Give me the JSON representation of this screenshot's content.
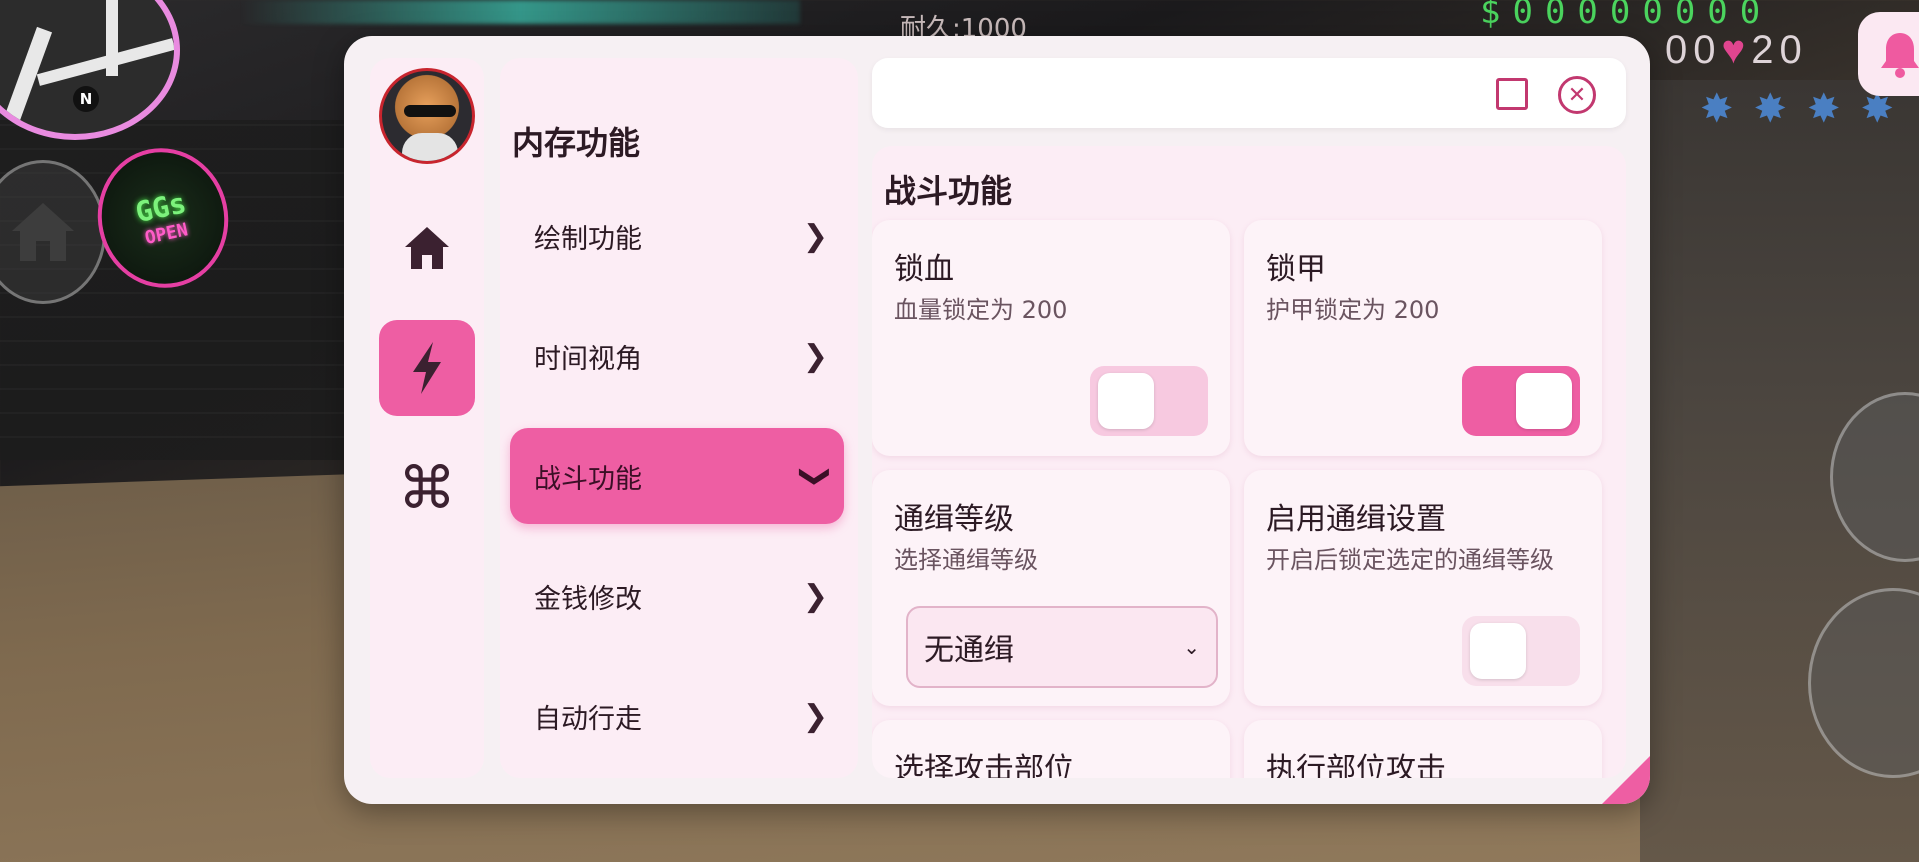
{
  "hud": {
    "durability": "耐久:1000",
    "money": "$00000000",
    "stats": "00",
    "heart": "♥",
    "lives": "20",
    "wanted_stars": "✸✸✸✸"
  },
  "minimap": {
    "north": "N"
  },
  "badge": {
    "main": "GGs",
    "sub": "OPEN"
  },
  "menu": {
    "title": "内存功能",
    "categories": [
      {
        "label": "绘制功能"
      },
      {
        "label": "时间视角"
      },
      {
        "label": "战斗功能"
      },
      {
        "label": "金钱修改"
      },
      {
        "label": "自动行走"
      }
    ],
    "active_category": "战斗功能",
    "section_title": "战斗功能",
    "cards": {
      "lock_health": {
        "title": "锁血",
        "desc": "血量锁定为 200",
        "enabled": false
      },
      "lock_armor": {
        "title": "锁甲",
        "desc": "护甲锁定为 200",
        "enabled": true
      },
      "wanted_level": {
        "title": "通缉等级",
        "desc": "选择通缉等级",
        "value": "无通缉"
      },
      "wanted_enable": {
        "title": "启用通缉设置",
        "desc": "开启后锁定选定的通缉等级",
        "enabled": false
      },
      "attack_part": {
        "title": "选择攻击部位"
      },
      "exec_attack": {
        "title": "执行部位攻击"
      }
    }
  },
  "colors": {
    "accent": "#ee5ea3",
    "panel_bg": "#f6f0f3",
    "card_bg": "#fdf3f8",
    "text": "#2c1a24"
  }
}
